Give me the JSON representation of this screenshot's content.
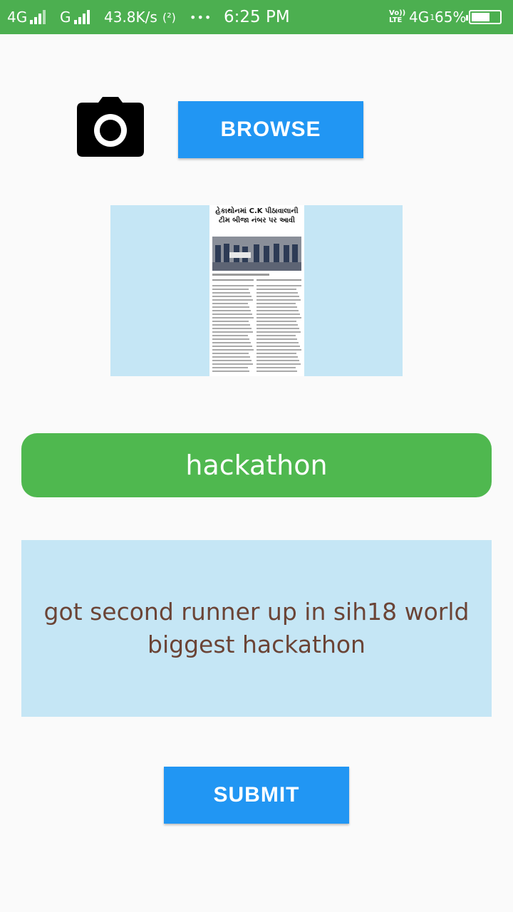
{
  "status_bar": {
    "network1": "4G",
    "network2": "G",
    "speed": "43.8K/s",
    "hotspot": "(²)",
    "more": "•••",
    "time": "6:25 PM",
    "volte": "Vo)) LTE",
    "network3": "4G",
    "network3_sub": "1",
    "battery": "65%",
    "battery_level": 0.65
  },
  "actions": {
    "camera_icon": "camera-icon",
    "browse_label": "BROWSE",
    "submit_label": "SUBMIT"
  },
  "preview": {
    "headline_line1": "હેકાથોનમાં C.K પીઠાવાલાની",
    "headline_line2": "ટીમ બીજા નંબર પર આવી"
  },
  "post": {
    "title": "hackathon",
    "description": "got second runner up in sih18 world biggest hackathon"
  },
  "colors": {
    "status_bar": "#4caf50",
    "button": "#2196f3",
    "title_pill": "#4fb84f",
    "description_bg": "#c5e6f5",
    "description_text": "#6b4436"
  }
}
